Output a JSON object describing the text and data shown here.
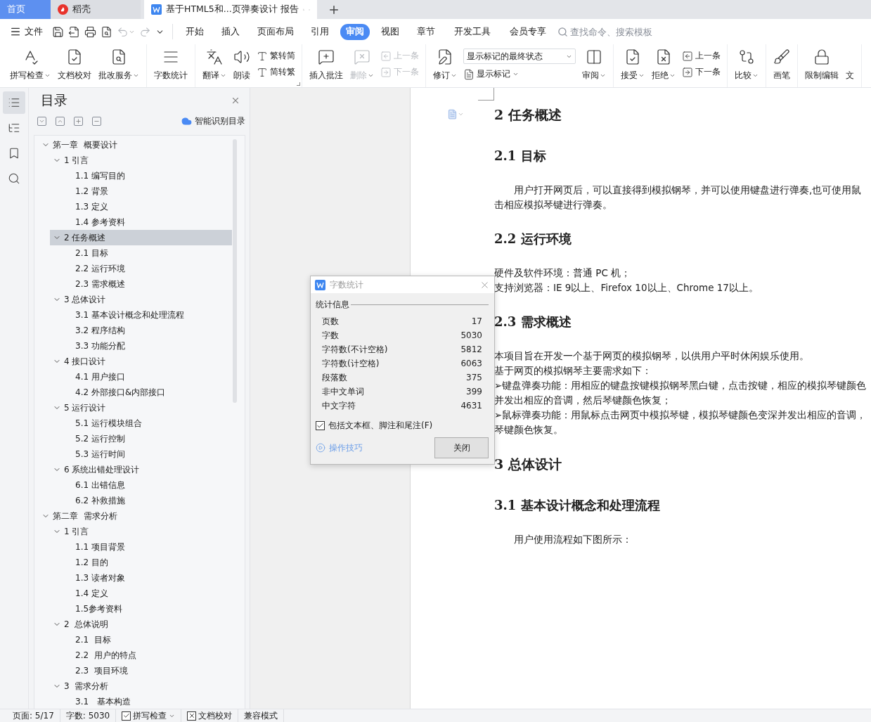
{
  "tabs": [
    {
      "label": "首页",
      "kind": "home",
      "selected": false
    },
    {
      "label": "稻壳",
      "kind": "app",
      "selected": false
    },
    {
      "label": "基于HTML5和...页弹奏设计 报告",
      "kind": "document",
      "selected": true
    }
  ],
  "menu": {
    "file": "文件",
    "quick_access": [
      {
        "disabled": false,
        "has_menu": false
      },
      {
        "disabled": false,
        "has_menu": false
      },
      {
        "disabled": false,
        "has_menu": false
      },
      {
        "disabled": false,
        "has_menu": false
      },
      {
        "disabled": true,
        "has_menu": true
      },
      {
        "disabled": true,
        "has_menu": false
      }
    ],
    "tabs": [
      {
        "label": "开始",
        "selected": false
      },
      {
        "label": "插入",
        "selected": false
      },
      {
        "label": "页面布局",
        "selected": false
      },
      {
        "label": "引用",
        "selected": false
      },
      {
        "label": "审阅",
        "selected": true
      },
      {
        "label": "视图",
        "selected": false
      },
      {
        "label": "章节",
        "selected": false
      },
      {
        "label": "开发工具",
        "selected": false
      },
      {
        "label": "会员专享",
        "selected": false
      }
    ],
    "search": {
      "placeholder": "查找命令、搜索模板"
    }
  },
  "ribbon": [
    {
      "launcher": false,
      "items": [
        {
          "kind": "large",
          "label": "拼写检查",
          "has_menu": true,
          "disabled": false
        },
        {
          "kind": "large",
          "label": "文档校对",
          "has_menu": false,
          "disabled": false
        },
        {
          "kind": "large",
          "label": "批改服务",
          "has_menu": true,
          "disabled": false
        }
      ]
    },
    {
      "launcher": false,
      "items": [
        {
          "kind": "large",
          "label": "字数统计",
          "has_menu": false,
          "disabled": false
        }
      ]
    },
    {
      "launcher": true,
      "items": [
        {
          "kind": "large",
          "label": "翻译",
          "has_menu": true,
          "disabled": false
        },
        {
          "kind": "large",
          "label": "朗读",
          "has_menu": false,
          "disabled": false
        },
        {
          "kind": "stack",
          "items": [
            {
              "label": "繁转简",
              "disabled": false
            },
            {
              "label": "简转繁",
              "disabled": false
            }
          ]
        }
      ]
    },
    {
      "launcher": false,
      "items": [
        {
          "kind": "large",
          "label": "插入批注",
          "has_menu": false,
          "disabled": false
        },
        {
          "kind": "large",
          "label": "删除",
          "has_menu": true,
          "disabled": true
        },
        {
          "kind": "stack",
          "items": [
            {
              "label": "上一条",
              "disabled": true
            },
            {
              "label": "下一条",
              "disabled": true
            }
          ]
        }
      ]
    },
    {
      "launcher": false,
      "items": [
        {
          "kind": "large",
          "label": "修订",
          "has_menu": true,
          "disabled": false
        },
        {
          "kind": "combo",
          "value": "显示标记的最终状态",
          "below": {
            "label": "显示标记",
            "has_menu": true
          }
        },
        {
          "kind": "large",
          "label": "审阅",
          "has_menu": true,
          "disabled": false
        }
      ]
    },
    {
      "launcher": false,
      "items": [
        {
          "kind": "large",
          "label": "接受",
          "has_menu": true,
          "disabled": false
        },
        {
          "kind": "large",
          "label": "拒绝",
          "has_menu": true,
          "disabled": false
        },
        {
          "kind": "stack",
          "items": [
            {
              "label": "上一条",
              "disabled": false
            },
            {
              "label": "下一条",
              "disabled": false
            }
          ]
        }
      ]
    },
    {
      "launcher": false,
      "items": [
        {
          "kind": "large",
          "label": "比较",
          "has_menu": true,
          "disabled": false
        }
      ]
    },
    {
      "launcher": false,
      "items": [
        {
          "kind": "large",
          "label": "画笔",
          "has_menu": false,
          "disabled": false
        }
      ]
    },
    {
      "launcher": false,
      "items": [
        {
          "kind": "large",
          "label": "限制编辑",
          "has_menu": false,
          "disabled": false
        },
        {
          "kind": "large",
          "label": "文",
          "has_menu": false,
          "disabled": false
        }
      ]
    }
  ],
  "nav_rail": [
    {
      "selected": true
    },
    {
      "selected": false
    },
    {
      "selected": false
    },
    {
      "selected": false
    }
  ],
  "toc": {
    "title": "目录",
    "smart_button": "智能识别目录",
    "items": [
      {
        "label": "第一章  概要设计",
        "expanded": true,
        "selected": false,
        "children": [
          {
            "label": "1 引言",
            "expanded": true,
            "selected": false,
            "children": [
              {
                "label": "1.1 编写目的",
                "selected": false
              },
              {
                "label": "1.2 背景",
                "selected": false
              },
              {
                "label": "1.3 定义",
                "selected": false
              },
              {
                "label": "1.4 参考资料",
                "selected": false
              }
            ]
          },
          {
            "label": "2 任务概述",
            "expanded": true,
            "selected": true,
            "children": [
              {
                "label": "2.1 目标",
                "selected": false
              },
              {
                "label": "2.2 运行环境",
                "selected": false
              },
              {
                "label": "2.3 需求概述",
                "selected": false
              }
            ]
          },
          {
            "label": "3 总体设计",
            "expanded": true,
            "selected": false,
            "children": [
              {
                "label": "3.1 基本设计概念和处理流程",
                "selected": false
              },
              {
                "label": "3.2 程序结构",
                "selected": false
              },
              {
                "label": "3.3 功能分配",
                "selected": false
              }
            ]
          },
          {
            "label": "4 接口设计",
            "expanded": true,
            "selected": false,
            "children": [
              {
                "label": "4.1 用户接口",
                "selected": false
              },
              {
                "label": "4.2 外部接口&内部接口",
                "selected": false
              }
            ]
          },
          {
            "label": "5 运行设计",
            "expanded": true,
            "selected": false,
            "children": [
              {
                "label": "5.1 运行模块组合",
                "selected": false
              },
              {
                "label": "5.2 运行控制",
                "selected": false
              },
              {
                "label": "5.3 运行时间",
                "selected": false
              }
            ]
          },
          {
            "label": "6 系统出错处理设计",
            "expanded": true,
            "selected": false,
            "children": [
              {
                "label": "6.1 出错信息",
                "selected": false
              },
              {
                "label": "6.2 补救措施",
                "selected": false
              }
            ]
          }
        ]
      },
      {
        "label": "第二章  需求分析",
        "expanded": true,
        "selected": false,
        "children": [
          {
            "label": "1 引言",
            "expanded": true,
            "selected": false,
            "children": [
              {
                "label": "1.1 项目背景",
                "selected": false
              },
              {
                "label": "1.2 目的",
                "selected": false
              },
              {
                "label": "1.3 读者对象",
                "selected": false
              },
              {
                "label": "1.4 定义",
                "selected": false
              },
              {
                "label": "1.5参考资料",
                "selected": false
              }
            ]
          },
          {
            "label": "2  总体说明",
            "expanded": true,
            "selected": false,
            "children": [
              {
                "label": "2.1  目标",
                "selected": false
              },
              {
                "label": "2.2  用户的特点",
                "selected": false
              },
              {
                "label": "2.3  项目环境",
                "selected": false
              }
            ]
          },
          {
            "label": "3  需求分析",
            "expanded": true,
            "selected": false,
            "children": [
              {
                "label": "3.1   基本构造",
                "selected": false
              }
            ]
          }
        ]
      }
    ]
  },
  "document": {
    "blocks": [
      {
        "kind": "heading1",
        "text": "2 任务概述"
      },
      {
        "kind": "heading2",
        "text": "2.1 目标"
      },
      {
        "kind": "paragraph",
        "indent": true,
        "lines": [
          "用户打开网页后，可以直接得到模拟钢琴，并可以使用键盘进行弹奏,也可使用鼠",
          "击相应模拟琴键进行弹奏。"
        ]
      },
      {
        "kind": "heading2",
        "text": "2.2 运行环境"
      },
      {
        "kind": "paragraph",
        "indent": false,
        "lines": [
          "硬件及软件环境：普通 PC 机；",
          "支持浏览器：IE 9以上、Firefox 10以上、Chrome 17以上。"
        ]
      },
      {
        "kind": "heading2",
        "text": "2.3 需求概述"
      },
      {
        "kind": "paragraph",
        "indent": false,
        "lines": [
          "本项目旨在开发一个基于网页的模拟钢琴，以供用户平时休闲娱乐使用。",
          "基于网页的模拟钢琴主要需求如下：",
          "➢键盘弹奏功能：用相应的键盘按键模拟钢琴黑白键，点击按键，相应的模拟琴键颜色",
          "并发出相应的音调，然后琴键颜色恢复；",
          "➢鼠标弹奏功能：用鼠标点击网页中模拟琴键，模拟琴键颜色变深并发出相应的音调，",
          "琴键颜色恢复。"
        ]
      },
      {
        "kind": "heading1",
        "text": "3 总体设计"
      },
      {
        "kind": "heading2",
        "text": "3.1 基本设计概念和处理流程"
      },
      {
        "kind": "paragraph",
        "indent": true,
        "lines": [
          "用户使用流程如下图所示："
        ]
      }
    ]
  },
  "dialog": {
    "title": "字数统计",
    "section": "统计信息",
    "rows": [
      {
        "label": "页数",
        "value": "17"
      },
      {
        "label": "字数",
        "value": "5030"
      },
      {
        "label": "字符数(不计空格)",
        "value": "5812"
      },
      {
        "label": "字符数(计空格)",
        "value": "6063"
      },
      {
        "label": "段落数",
        "value": "375"
      },
      {
        "label": "非中文单词",
        "value": "399"
      },
      {
        "label": "中文字符",
        "value": "4631"
      }
    ],
    "include_option": {
      "label": "包括文本框、脚注和尾注(F)",
      "checked": true
    },
    "tips_link": "操作技巧",
    "close_button": "关闭"
  },
  "status_bar": [
    {
      "kind": "text",
      "label": "页面: 5/17"
    },
    {
      "kind": "text",
      "label": "字数: 5030"
    },
    {
      "kind": "check",
      "label": "拼写检查",
      "checked": true,
      "has_menu": true
    },
    {
      "kind": "tool",
      "label": "文档校对"
    },
    {
      "kind": "text",
      "label": "兼容模式"
    }
  ]
}
